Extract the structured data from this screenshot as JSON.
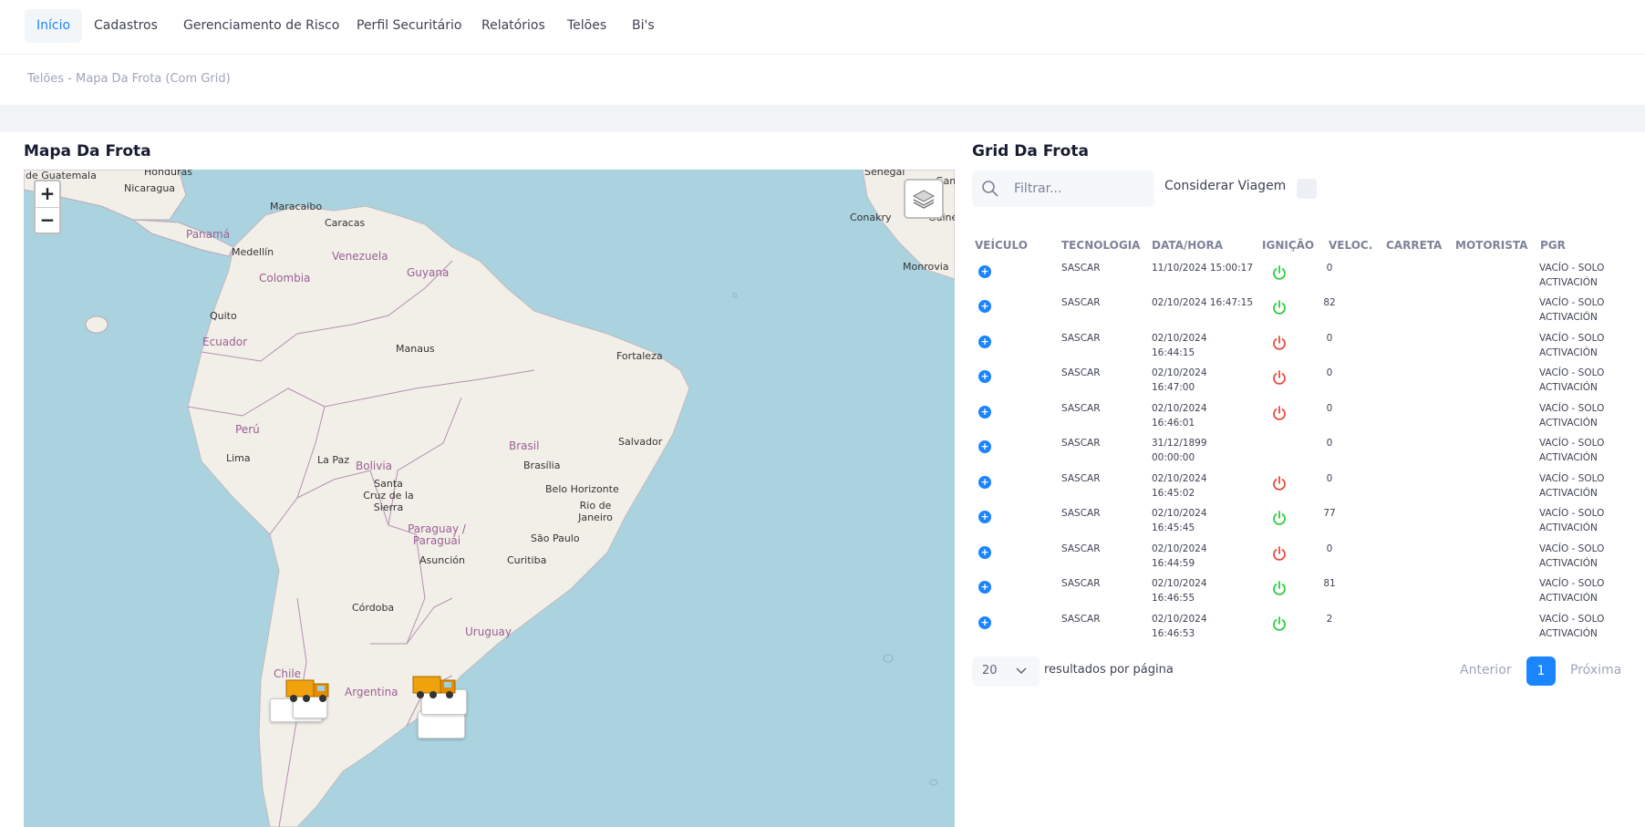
{
  "nav": {
    "items": [
      {
        "label": "Início",
        "active": true
      },
      {
        "label": "Cadastros"
      },
      {
        "label": "Gerenciamento de Risco"
      },
      {
        "label": "Perfil Securitário"
      },
      {
        "label": "Relatórios"
      },
      {
        "label": "Telões"
      },
      {
        "label": "Bi's"
      }
    ]
  },
  "breadcrumb": "Telões - Mapa Da Frota (Com Grid)",
  "map_panel": {
    "title": "Mapa Da Frota",
    "zoom_in": "+",
    "zoom_out": "−",
    "labels": {
      "guatemala": "de Guatemala",
      "honduras": "Honduras",
      "nicaragua": "Nicaragua",
      "maracaibo": "Maracaibo",
      "caracas": "Caracas",
      "panama": "Panamá",
      "medellin": "Medellín",
      "venezuela": "Venezuela",
      "colombia": "Colombia",
      "guyana": "Guyana",
      "quito": "Quito",
      "ecuador": "Ecuador",
      "manaus": "Manaus",
      "fortaleza": "Fortaleza",
      "peru": "Perú",
      "lima": "Lima",
      "brasil": "Brasil",
      "salvador": "Salvador",
      "la_paz": "La Paz",
      "bolivia": "Bolivia",
      "brasilia": "Brasília",
      "santa_cruz": "Santa Cruz de la Sierra",
      "belo_horizonte": "Belo Horizonte",
      "rio": "Rio de Janeiro",
      "paraguay": "Paraguay / Paraguái",
      "sao_paulo": "São Paulo",
      "asuncion": "Asunción",
      "curitiba": "Curitiba",
      "cordoba": "Córdoba",
      "uruguay": "Uruguay",
      "chile": "Chile",
      "argentina": "Argentina",
      "senegal": "Sénégal",
      "conakry": "Conakry",
      "guinee": "Guinée",
      "monrovia": "Monrovia",
      "gam": "Gam"
    },
    "truck_icon": "truck-icon",
    "layers_icon": "layers-icon"
  },
  "grid_panel": {
    "title": "Grid Da Frota",
    "search_placeholder": "Filtrar...",
    "consider_trip_label": "Considerar Viagem",
    "columns": [
      "VEÍCULO",
      "TECNOLOGIA",
      "DATA/HORA",
      "IGNIÇÃO",
      "VELOC.",
      "CARRETA",
      "MOTORISTA",
      "PGR"
    ],
    "rows": [
      {
        "tech": "SASCAR",
        "date": "11/10/2024 15:00:17",
        "time": "",
        "ignition": "on",
        "speed": "0",
        "pgr1": "VACÍO - SOLO",
        "pgr2": "ACTIVACIÓN"
      },
      {
        "tech": "SASCAR",
        "date": "02/10/2024 16:47:15",
        "time": "",
        "ignition": "on",
        "speed": "82",
        "pgr1": "VACÍO - SOLO",
        "pgr2": "ACTIVACIÓN"
      },
      {
        "tech": "SASCAR",
        "date": "02/10/2024",
        "time": "16:44:15",
        "ignition": "off",
        "speed": "0",
        "pgr1": "VACÍO - SOLO",
        "pgr2": "ACTIVACIÓN"
      },
      {
        "tech": "SASCAR",
        "date": "02/10/2024",
        "time": "16:47:00",
        "ignition": "off",
        "speed": "0",
        "pgr1": "VACÍO - SOLO",
        "pgr2": "ACTIVACIÓN"
      },
      {
        "tech": "SASCAR",
        "date": "02/10/2024",
        "time": "16:46:01",
        "ignition": "off",
        "speed": "0",
        "pgr1": "VACÍO - SOLO",
        "pgr2": "ACTIVACIÓN"
      },
      {
        "tech": "SASCAR",
        "date": "31/12/1899",
        "time": "00:00:00",
        "ignition": "none",
        "speed": "0",
        "pgr1": "VACÍO - SOLO",
        "pgr2": "ACTIVACIÓN"
      },
      {
        "tech": "SASCAR",
        "date": "02/10/2024",
        "time": "16:45:02",
        "ignition": "off",
        "speed": "0",
        "pgr1": "VACÍO - SOLO",
        "pgr2": "ACTIVACIÓN"
      },
      {
        "tech": "SASCAR",
        "date": "02/10/2024",
        "time": "16:45:45",
        "ignition": "on",
        "speed": "77",
        "pgr1": "VACÍO - SOLO",
        "pgr2": "ACTIVACIÓN"
      },
      {
        "tech": "SASCAR",
        "date": "02/10/2024",
        "time": "16:44:59",
        "ignition": "off",
        "speed": "0",
        "pgr1": "VACÍO - SOLO",
        "pgr2": "ACTIVACIÓN"
      },
      {
        "tech": "SASCAR",
        "date": "02/10/2024",
        "time": "16:46:55",
        "ignition": "on",
        "speed": "81",
        "pgr1": "VACÍO - SOLO",
        "pgr2": "ACTIVACIÓN"
      },
      {
        "tech": "SASCAR",
        "date": "02/10/2024",
        "time": "16:46:53",
        "ignition": "on",
        "speed": "2",
        "pgr1": "VACÍO - SOLO",
        "pgr2": "ACTIVACIÓN"
      }
    ],
    "page_size": "20",
    "results_label": "resultados por página",
    "prev_label": "Anterior",
    "current_page": "1",
    "next_label": "Próxima"
  },
  "colors": {
    "accent": "#1b84ff",
    "ignition_on": "#2ecc40",
    "ignition_off": "#e74c3c",
    "water": "#aad3df",
    "land": "#f2efe9"
  }
}
